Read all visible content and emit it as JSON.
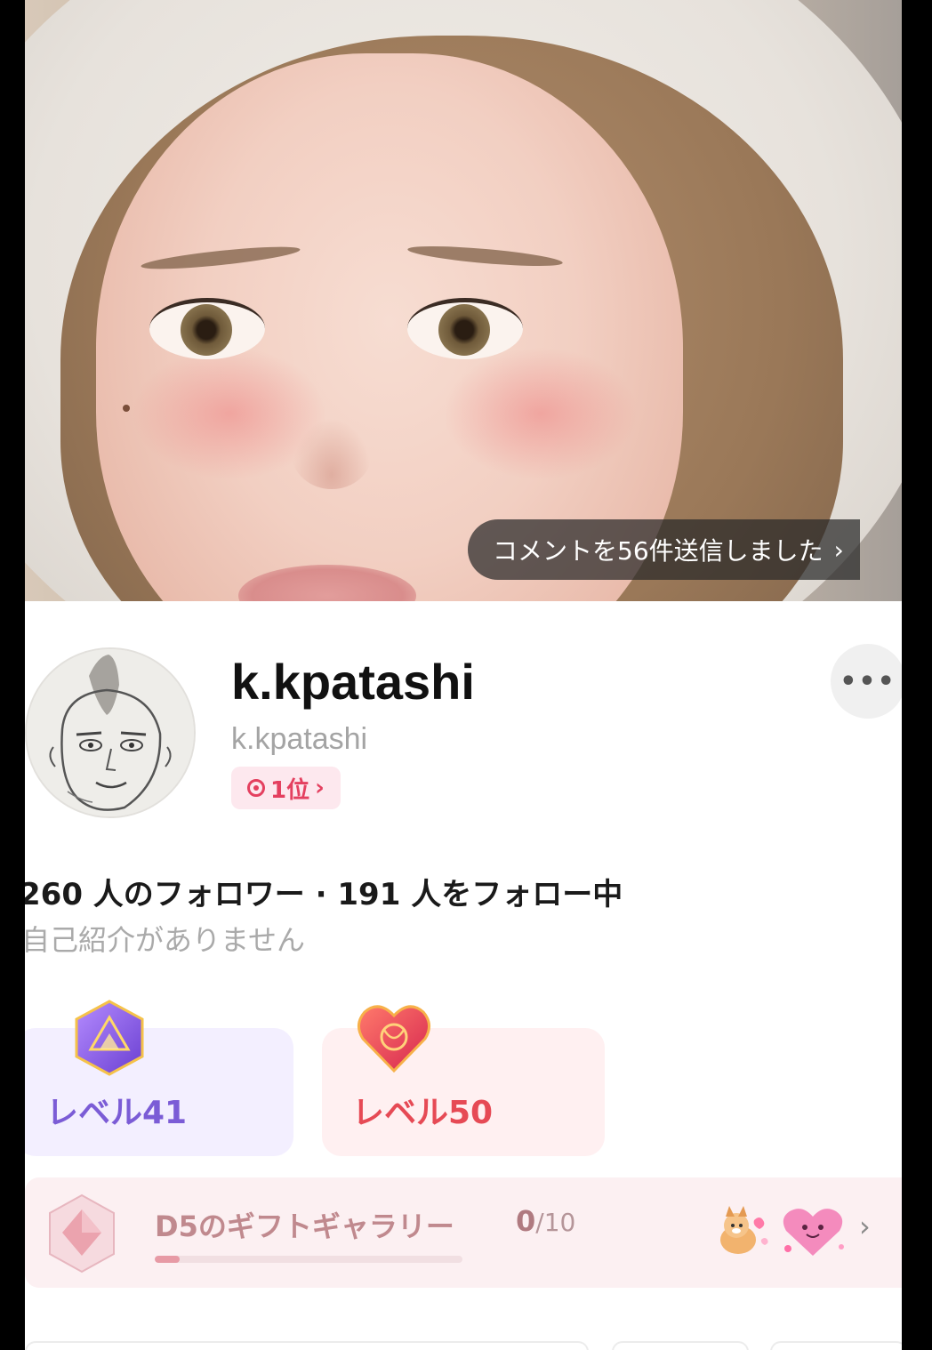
{
  "comment_banner": {
    "text": "コメントを56件送信しました",
    "chevron": "›"
  },
  "profile": {
    "display_name": "k.kpatashi",
    "handle": "k.kpatashi",
    "rank": "1位",
    "rank_chevron": "›",
    "more_label": "•••",
    "follow_stats": "260 人のフォロワー · 191 人をフォロー中",
    "bio": "自己紹介がありません"
  },
  "levels": [
    {
      "label": "レベル41",
      "icon": "purple-gem-icon",
      "color": "#7b5cd6"
    },
    {
      "label": "レベル50",
      "icon": "heart-badge-icon",
      "color": "#e64a55"
    }
  ],
  "gift_gallery": {
    "title": "D5のギフトギャラリー",
    "collected": "0",
    "total": "/10",
    "progress_fraction": 0.08,
    "chevron": "›",
    "stickers": [
      "corgi-sticker-icon",
      "pink-heart-sticker-icon"
    ]
  },
  "colors": {
    "accent_red": "#e4405f",
    "level_purple": "#7b5cd6",
    "level_red": "#e64a55"
  }
}
